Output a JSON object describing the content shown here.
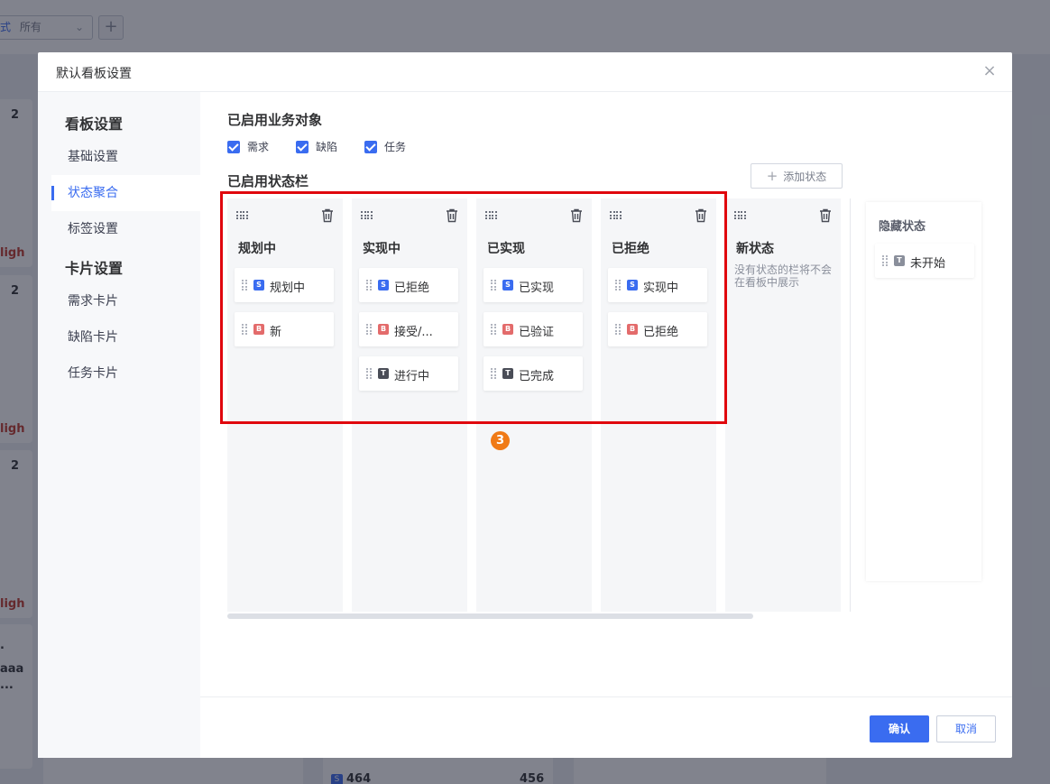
{
  "background": {
    "filter_label": "式",
    "filter_value": "所有",
    "card_counts": [
      "2",
      "2",
      "2"
    ],
    "priority_labels": [
      "ligh",
      "ligh",
      "ligh"
    ],
    "partial_texts": [
      ".",
      "aaa",
      "..."
    ],
    "bottom_card": {
      "tag": "S",
      "id": "464",
      "value": "456"
    }
  },
  "modal": {
    "title": "默认看板设置",
    "close_glyph": "×"
  },
  "sidebar": {
    "group_board": "看板设置",
    "items_board": [
      {
        "label": "基础设置"
      },
      {
        "label": "状态聚合"
      },
      {
        "label": "标签设置"
      }
    ],
    "group_card": "卡片设置",
    "items_card": [
      {
        "label": "需求卡片"
      },
      {
        "label": "缺陷卡片"
      },
      {
        "label": "任务卡片"
      }
    ],
    "active": "状态聚合"
  },
  "content": {
    "enabled_objects_title": "已启用业务对象",
    "objects": [
      {
        "label": "需求",
        "checked": true
      },
      {
        "label": "缺陷",
        "checked": true
      },
      {
        "label": "任务",
        "checked": true
      }
    ],
    "enabled_columns_title": "已启用状态栏",
    "add_status_label": "添加状态",
    "columns": [
      {
        "name": "规划中",
        "chips": [
          {
            "tag": "S",
            "kind": "s",
            "label": "规划中"
          },
          {
            "tag": "B",
            "kind": "b",
            "label": "新"
          }
        ]
      },
      {
        "name": "实现中",
        "chips": [
          {
            "tag": "S",
            "kind": "s",
            "label": "已拒绝"
          },
          {
            "tag": "B",
            "kind": "b",
            "label": "接受/..."
          },
          {
            "tag": "T",
            "kind": "t",
            "label": "进行中"
          }
        ]
      },
      {
        "name": "已实现",
        "chips": [
          {
            "tag": "S",
            "kind": "s",
            "label": "已实现"
          },
          {
            "tag": "B",
            "kind": "b",
            "label": "已验证"
          },
          {
            "tag": "T",
            "kind": "t",
            "label": "已完成"
          }
        ]
      },
      {
        "name": "已拒绝",
        "chips": [
          {
            "tag": "S",
            "kind": "s",
            "label": "实现中"
          },
          {
            "tag": "B",
            "kind": "b",
            "label": "已拒绝"
          }
        ]
      },
      {
        "name": "新状态",
        "hint": "没有状态的栏将不会在看板中展示",
        "chips": []
      }
    ],
    "hidden_title": "隐藏状态",
    "hidden_chips": [
      {
        "tag": "T",
        "kind": "t-grey",
        "label": "未开始"
      }
    ],
    "step_badge": "3"
  },
  "footer": {
    "confirm_label": "确认",
    "cancel_label": "取消"
  },
  "colors": {
    "accent": "#3a6cf0",
    "highlight": "#e0070d",
    "badge": "#f07a16"
  }
}
